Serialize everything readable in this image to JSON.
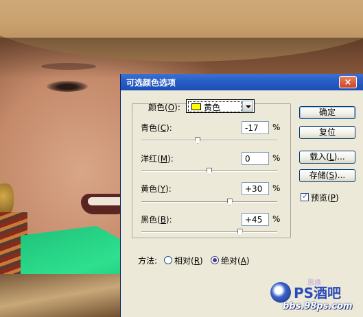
{
  "dialog": {
    "title": "可选颜色选项",
    "close_glyph": "×",
    "colors_label": "颜色(",
    "colors_key": "O",
    "colors_label_end": "):",
    "color_value": "黄色",
    "swatch_color": "#ffff00",
    "sliders": [
      {
        "label": "青色(",
        "key": "C",
        "end": "):",
        "value": "-17",
        "unit": "%",
        "level": -17
      },
      {
        "label": "洋红(",
        "key": "M",
        "end": "):",
        "value": "0",
        "unit": "%",
        "level": 0
      },
      {
        "label": "黄色(",
        "key": "Y",
        "end": "):",
        "value": "+30",
        "unit": "%",
        "level": 30
      },
      {
        "label": "黑色(",
        "key": "B",
        "end": "):",
        "value": "+45",
        "unit": "%",
        "level": 45
      }
    ],
    "buttons": {
      "ok": "确定",
      "reset": "复位",
      "load_pre": "载入(",
      "load_key": "L",
      "load_post": ")...",
      "save_pre": "存储(",
      "save_key": "S",
      "save_post": ")..."
    },
    "preview": {
      "pre": "预览(",
      "key": "P",
      "post": ")",
      "checked": true
    },
    "method": {
      "label": "方法:",
      "relative_pre": "相对(",
      "relative_key": "R",
      "relative_post": ")",
      "absolute_pre": "绝对(",
      "absolute_key": "A",
      "absolute_post": ")",
      "selected": "absolute"
    }
  },
  "watermark": {
    "brand": "PS酒吧",
    "url": "bbs.98ps.com",
    "chars": "思缘"
  }
}
